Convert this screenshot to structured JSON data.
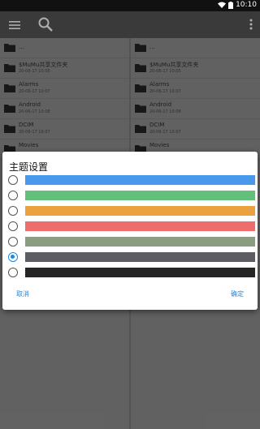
{
  "status_bar": {
    "time": "10:10"
  },
  "toolbar": {
    "menu_icon": "hamburger-menu-icon",
    "search_icon": "search-icon",
    "more_icon": "overflow-menu-icon"
  },
  "left_pane": {
    "items": [
      {
        "name": "...",
        "date": ""
      },
      {
        "name": "$MuMu共享文件夹",
        "date": "20-06-17 10:05"
      },
      {
        "name": "Alarms",
        "date": "20-06-17 10:07"
      },
      {
        "name": "Android",
        "date": "20-06-17 10:08"
      },
      {
        "name": "DCIM",
        "date": "20-06-17 10:07"
      },
      {
        "name": "Movies",
        "date": ""
      }
    ]
  },
  "right_pane": {
    "items": [
      {
        "name": "...",
        "date": ""
      },
      {
        "name": "$MuMu共享文件夹",
        "date": "20-06-17 10:05"
      },
      {
        "name": "Alarms",
        "date": "20-06-17 10:07"
      },
      {
        "name": "Android",
        "date": "20-06-17 10:08"
      },
      {
        "name": "DCIM",
        "date": "20-06-17 10:07"
      },
      {
        "name": "Movies",
        "date": ""
      }
    ]
  },
  "dialog": {
    "title": "主题设置",
    "options": [
      {
        "color": "#4a98ec",
        "selected": false
      },
      {
        "color": "#62c07a",
        "selected": false
      },
      {
        "color": "#eba23e",
        "selected": false
      },
      {
        "color": "#ee6e6e",
        "selected": false
      },
      {
        "color": "#8a9c82",
        "selected": false
      },
      {
        "color": "#5c5d63",
        "selected": true
      },
      {
        "color": "#262626",
        "selected": false
      }
    ],
    "cancel_label": "取消",
    "ok_label": "确定"
  }
}
